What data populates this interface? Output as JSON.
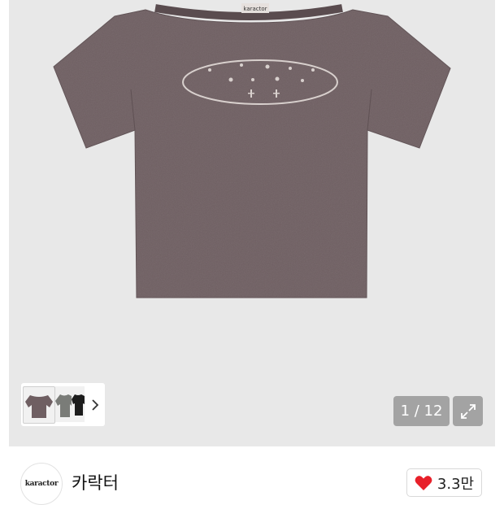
{
  "gallery": {
    "current_index": "1",
    "separator": "/",
    "total": "12",
    "counter_text": "1 / 12",
    "background_color": "#e8e8e8",
    "shirt_color": "#6f5f62",
    "thumbnails": [
      {
        "name": "purple-tee-thumb",
        "color": "#6f5f62"
      },
      {
        "name": "grey-tee-thumb",
        "color": "#7a7c78"
      },
      {
        "name": "black-tee-thumb",
        "color": "#1c1c1c"
      }
    ],
    "next_icon": "chevron-right-icon",
    "expand_icon": "expand-icon"
  },
  "brand": {
    "logo_text": "karactor",
    "name": "카락터"
  },
  "like": {
    "icon": "heart-icon",
    "icon_color": "#e8202a",
    "count": "3.3만"
  }
}
